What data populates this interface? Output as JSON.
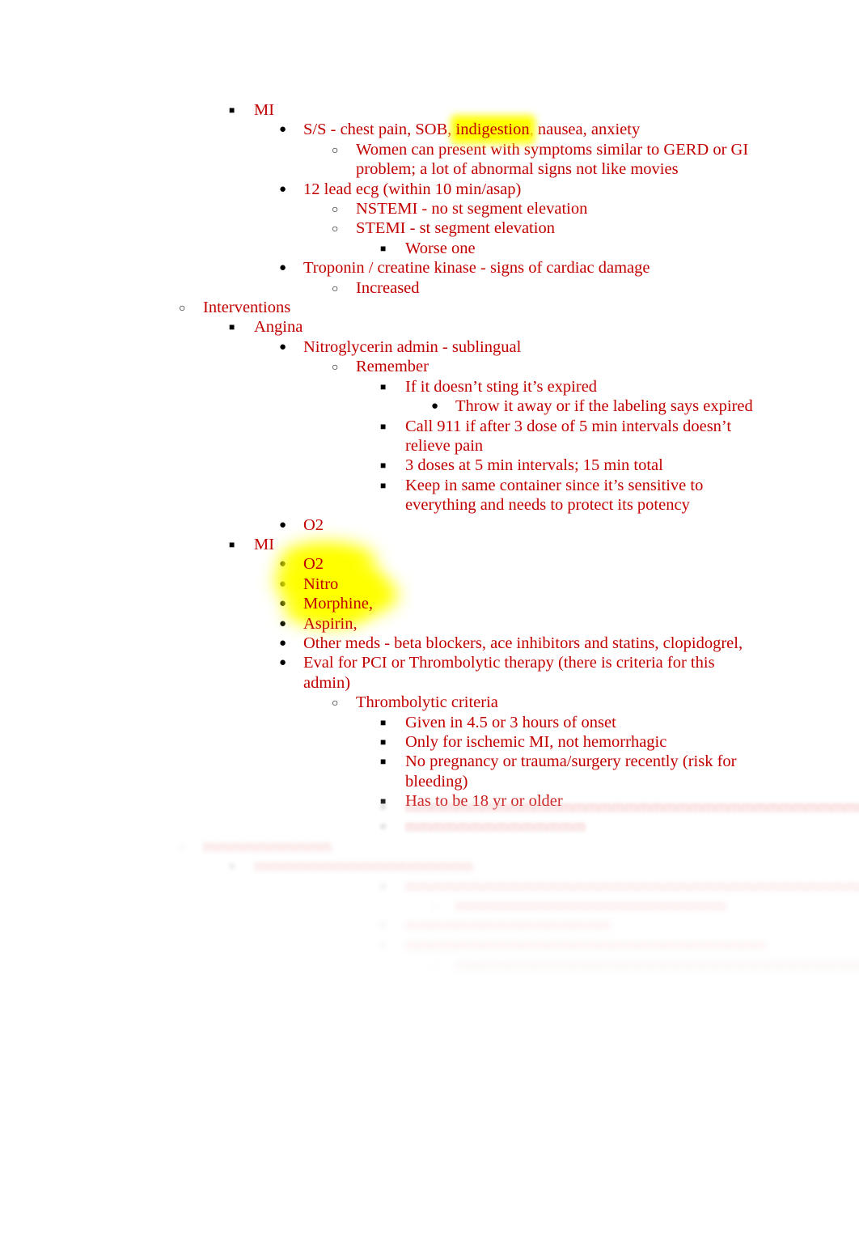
{
  "document": {
    "title": "Cardiac Nursing Notes Outline",
    "text_color": "#c20000",
    "marker_color": "#000000",
    "highlight_color": "#ffff00",
    "page_background": "#ffffff"
  },
  "outline": [
    {
      "id": "mi-signs",
      "level": 2,
      "marker": "filled-square",
      "text": "MI"
    },
    {
      "id": "ss",
      "level": 3,
      "marker": "filled-disc",
      "text_before": "S/S - chest pain, SOB, ",
      "highlight": "indigestion",
      "text_after": ", nausea, anxiety"
    },
    {
      "id": "women-present",
      "level": 4,
      "marker": "hollow-circle",
      "text": "Women can present with symptoms similar to GERD or GI problem; a lot of abnormal signs not like movies"
    },
    {
      "id": "ecg",
      "level": 3,
      "marker": "filled-disc",
      "text": "12 lead ecg (within 10 min/asap)"
    },
    {
      "id": "nstemi",
      "level": 4,
      "marker": "hollow-circle",
      "text": "NSTEMI - no st segment elevation"
    },
    {
      "id": "stemi",
      "level": 4,
      "marker": "hollow-circle",
      "text": "STEMI - st segment elevation"
    },
    {
      "id": "worse-one",
      "level": 5,
      "marker": "filled-square",
      "text": "Worse one"
    },
    {
      "id": "troponin",
      "level": 3,
      "marker": "filled-disc",
      "text": "Troponin / creatine kinase - signs of cardiac damage"
    },
    {
      "id": "increased",
      "level": 4,
      "marker": "hollow-circle",
      "text": "Increased"
    },
    {
      "id": "interventions",
      "level": 1,
      "marker": "hollow-circle",
      "text": "Interventions"
    },
    {
      "id": "angina",
      "level": 2,
      "marker": "filled-square",
      "text": "Angina"
    },
    {
      "id": "nitro-admin",
      "level": 3,
      "marker": "filled-disc",
      "text": "Nitroglycerin admin - sublingual"
    },
    {
      "id": "remember",
      "level": 4,
      "marker": "hollow-circle",
      "text": "Remember"
    },
    {
      "id": "sting-expired",
      "level": 5,
      "marker": "filled-square",
      "text": "If it doesn’t sting it’s expired"
    },
    {
      "id": "throw-away",
      "level": 6,
      "marker": "filled-disc",
      "text": "Throw it away or if the labeling says expired"
    },
    {
      "id": "call-911",
      "level": 5,
      "marker": "filled-square",
      "text": "Call 911 if after 3 dose of 5 min intervals doesn’t relieve pain"
    },
    {
      "id": "three-doses",
      "level": 5,
      "marker": "filled-square",
      "text": "3 doses at 5 min intervals; 15 min total"
    },
    {
      "id": "same-container",
      "level": 5,
      "marker": "filled-square",
      "text": "Keep in same container since it’s sensitive to everything and needs to protect its potency"
    },
    {
      "id": "angina-o2",
      "level": 3,
      "marker": "filled-disc",
      "text": "O2"
    },
    {
      "id": "mi-interventions",
      "level": 2,
      "marker": "filled-square",
      "text": "MI"
    },
    {
      "id": "mi-o2",
      "level": 3,
      "marker": "filled-disc",
      "text": "O2",
      "highlighted": true
    },
    {
      "id": "mi-nitro",
      "level": 3,
      "marker": "filled-disc",
      "text": "Nitro",
      "highlighted": true
    },
    {
      "id": "mi-morphine",
      "level": 3,
      "marker": "filled-disc",
      "text": "Morphine,",
      "highlighted": true
    },
    {
      "id": "mi-aspirin",
      "level": 3,
      "marker": "filled-disc",
      "text": "Aspirin,",
      "highlighted": true
    },
    {
      "id": "other-meds",
      "level": 3,
      "marker": "filled-disc",
      "text": "Other meds - beta blockers, ace inhibitors and statins, clopidogrel,"
    },
    {
      "id": "eval-pci",
      "level": 3,
      "marker": "filled-disc",
      "text": "Eval for PCI or Thrombolytic therapy (there is criteria for this admin)"
    },
    {
      "id": "thrombolytic-criteria",
      "level": 4,
      "marker": "hollow-circle",
      "text": "Thrombolytic criteria"
    },
    {
      "id": "given-hours",
      "level": 5,
      "marker": "filled-square",
      "text": "Given in 4.5 or 3 hours of onset"
    },
    {
      "id": "ischemic-only",
      "level": 5,
      "marker": "filled-square",
      "text": "Only for ischemic MI, not hemorrhagic"
    },
    {
      "id": "no-pregnancy",
      "level": 5,
      "marker": "filled-square",
      "text": "No pregnancy or trauma/surgery recently (risk for bleeding)"
    },
    {
      "id": "age-18",
      "level": 5,
      "marker": "filled-square",
      "text": "Has to be 18 yr or older"
    }
  ],
  "obscured_tail": {
    "note": "Lower portion of the page is blurred and faded out; text is not legible.",
    "rows": [
      {
        "id": "t1",
        "level": 5,
        "marker": "filled-square",
        "fade": "fade-a",
        "width_ch": 47
      },
      {
        "id": "t2",
        "level": 5,
        "marker": "filled-square",
        "fade": "fade-a",
        "width_ch": 14
      },
      {
        "id": "t3",
        "level": 1,
        "marker": "hollow-circle",
        "fade": "fade-b",
        "width_ch": 10
      },
      {
        "id": "t4",
        "level": 2,
        "marker": "filled-square",
        "fade": "fade-b",
        "width_ch": 17
      },
      {
        "id": "t5",
        "level": 5,
        "marker": "filled-square",
        "fade": "fade-c",
        "width_ch": 45
      },
      {
        "id": "t6",
        "level": 6,
        "marker": "hollow-circle",
        "fade": "fade-c",
        "width_ch": 21
      },
      {
        "id": "t7",
        "level": 5,
        "marker": "filled-square",
        "fade": "fade-d",
        "width_ch": 16
      },
      {
        "id": "t8",
        "level": 5,
        "marker": "filled-square",
        "fade": "fade-d",
        "width_ch": 28
      },
      {
        "id": "t9",
        "level": 6,
        "marker": "hollow-circle",
        "fade": "fade-e",
        "width_ch": 39
      }
    ]
  }
}
